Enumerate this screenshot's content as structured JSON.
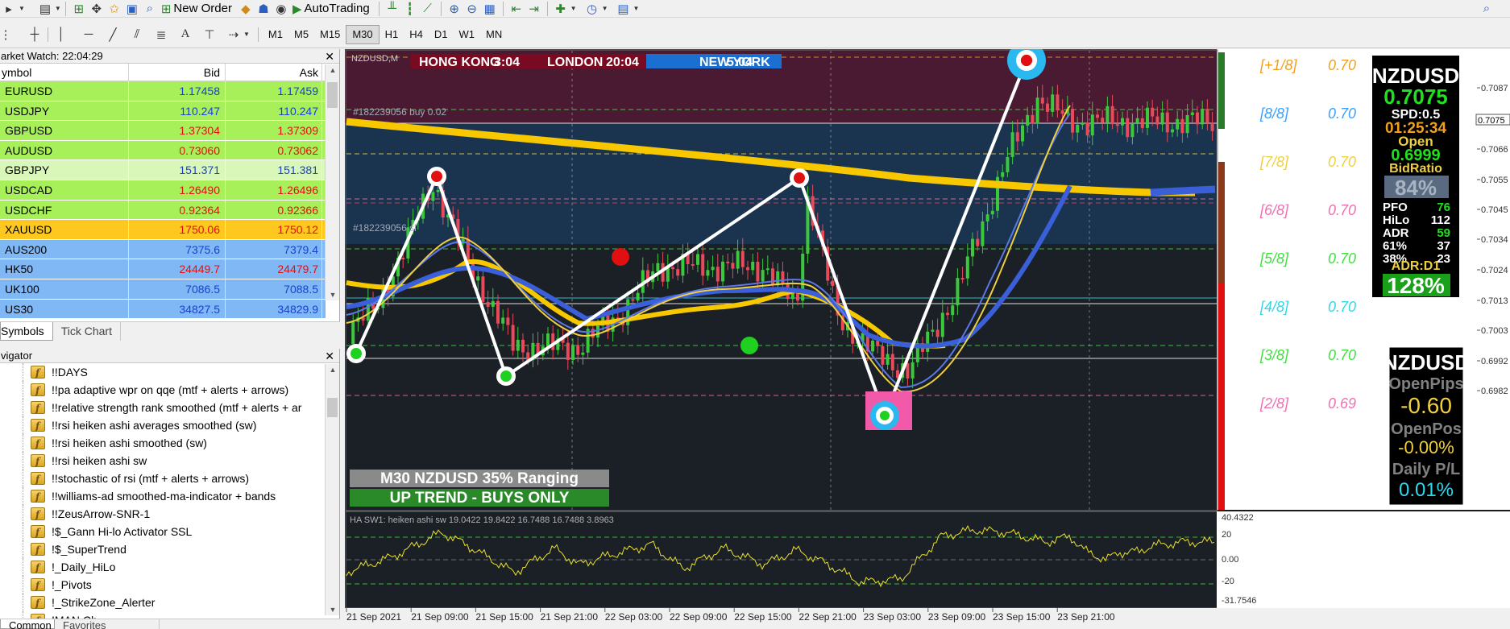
{
  "toolbar": {
    "new_order": "New Order",
    "autotrading": "AutoTrading",
    "periods": [
      "M1",
      "M5",
      "M15",
      "M30",
      "H1",
      "H4",
      "D1",
      "W1",
      "MN"
    ],
    "active_period": "M30"
  },
  "market_watch": {
    "title": "arket Watch: 22:04:29",
    "col_symbol": "ymbol",
    "col_bid": "Bid",
    "col_ask": "Ask",
    "rows": [
      {
        "symbol": "EURUSD",
        "bid": "1.17458",
        "ask": "1.17459",
        "bg": "#a8f05a",
        "fg": "#1a40d0"
      },
      {
        "symbol": "USDJPY",
        "bid": "110.247",
        "ask": "110.247",
        "bg": "#a8f05a",
        "fg": "#1a40d0"
      },
      {
        "symbol": "GBPUSD",
        "bid": "1.37304",
        "ask": "1.37309",
        "bg": "#a8f05a",
        "fg": "#e01010"
      },
      {
        "symbol": "AUDUSD",
        "bid": "0.73060",
        "ask": "0.73062",
        "bg": "#a8f05a",
        "fg": "#e01010"
      },
      {
        "symbol": "GBPJPY",
        "bid": "151.371",
        "ask": "151.381",
        "bg": "#d8f7b8",
        "fg": "#1a40d0"
      },
      {
        "symbol": "USDCAD",
        "bid": "1.26490",
        "ask": "1.26496",
        "bg": "#a8f05a",
        "fg": "#e01010"
      },
      {
        "symbol": "USDCHF",
        "bid": "0.92364",
        "ask": "0.92366",
        "bg": "#a8f05a",
        "fg": "#e01010"
      },
      {
        "symbol": "XAUUSD",
        "bid": "1750.06",
        "ask": "1750.12",
        "bg": "#ffc81e",
        "fg": "#e01010"
      },
      {
        "symbol": "AUS200",
        "bid": "7375.6",
        "ask": "7379.4",
        "bg": "#7fb8f5",
        "fg": "#1a40d0"
      },
      {
        "symbol": "HK50",
        "bid": "24449.7",
        "ask": "24479.7",
        "bg": "#7fb8f5",
        "fg": "#e01010"
      },
      {
        "symbol": "UK100",
        "bid": "7086.5",
        "ask": "7088.5",
        "bg": "#7fb8f5",
        "fg": "#1a40d0"
      },
      {
        "symbol": "US30",
        "bid": "34827.5",
        "ask": "34829.9",
        "bg": "#7fb8f5",
        "fg": "#1a40d0"
      }
    ],
    "tabs": [
      "Symbols",
      "Tick Chart"
    ]
  },
  "navigator": {
    "title": "vigator",
    "items": [
      "!!DAYS",
      "!!pa adaptive wpr on qqe (mtf + alerts + arrows)",
      "!!relative strength rank smoothed (mtf + alerts + ar",
      "!!rsi heiken ashi averages smoothed (sw)",
      "!!rsi heiken ashi smoothed (sw)",
      "!!rsi heiken ashi sw",
      "!!stochastic of rsi  (mtf + alerts + arrows)",
      "!!williams-ad smoothed-ma-indicator + bands",
      "!!ZeusArrow-SNR-1",
      "!$_Gann Hi-lo Activator SSL",
      "!$_SuperTrend",
      "!_Daily_HiLo",
      "!_Pivots",
      "!_StrikeZone_Alerter",
      "!MAN Ch..."
    ],
    "tabs": [
      "Common",
      "Favorites"
    ]
  },
  "chart": {
    "symbol_label": "NZDUSD,M",
    "sessions": [
      "HONG KONG",
      "3:04",
      "LONDON",
      "20:04",
      "NEW YORK",
      "5:04"
    ],
    "order_line_buy": "#182239056 buy 0.02",
    "order_line_sl": "#182239056 sl",
    "regime_text": "M30 NZDUSD 35% Ranging",
    "trend_text": "UP TREND - BUYS ONLY",
    "murrey_labels": [
      "[+1/8]",
      "[8/8]",
      "[7/8]",
      "[6/8]",
      "[5/8]",
      "[4/8]",
      "[3/8]",
      "[2/8]"
    ],
    "murrey_values": [
      "0.70",
      "0.70",
      "0.70",
      "0.70",
      "0.70",
      "0.70",
      "0.70",
      "0.69"
    ],
    "murrey_colors": [
      "#f0a020",
      "#3aa0ff",
      "#f0d040",
      "#f070b0",
      "#40e040",
      "#30d8e8",
      "#40e040",
      "#f070b0"
    ],
    "price_axis": [
      "0.7087",
      "0.7075",
      "0.7066",
      "0.7055",
      "0.7045",
      "0.7034",
      "0.7024",
      "0.7013",
      "0.7003",
      "0.6992",
      "0.6982"
    ],
    "current_price": "0.7075",
    "time_axis": [
      "21 Sep 2021",
      "21 Sep 09:00",
      "21 Sep 15:00",
      "21 Sep 21:00",
      "22 Sep 03:00",
      "22 Sep 09:00",
      "22 Sep 15:00",
      "22 Sep 21:00",
      "23 Sep 03:00",
      "23 Sep 09:00",
      "23 Sep 15:00",
      "23 Sep 21:00"
    ],
    "osc_label": "HA SW1: heiken ashi sw 19.0422 19.8422 16.7488 16.7488 3.8963",
    "osc_axis": [
      "40.4322",
      "20",
      "0.00",
      "-20",
      "-31.7546"
    ]
  },
  "info_panel": {
    "symbol": "NZDUSD",
    "price": "0.7075",
    "spread": "SPD:0.5",
    "timer": "01:25:34",
    "open_label": "Open",
    "open_value": "0.6999",
    "bidratio_label": "BidRatio",
    "bidratio_value": "84%",
    "stats": [
      {
        "k": "PFO",
        "v": "76"
      },
      {
        "k": "HiLo",
        "v": "112"
      },
      {
        "k": "ADR",
        "v": "59"
      },
      {
        "k": "61%",
        "v": "37"
      },
      {
        "k": "38%",
        "v": "23"
      }
    ],
    "adr_label": "ADR:D1",
    "adr_value": "128%"
  },
  "pips_panel": {
    "symbol": "NZDUSD",
    "openpips_label": "OpenPips",
    "openpips_value": "-0.60",
    "openpos_label": "OpenPos",
    "openpos_value": "-0.00%",
    "dailypl_label": "Daily P/L",
    "dailypl_value": "0.01%"
  }
}
